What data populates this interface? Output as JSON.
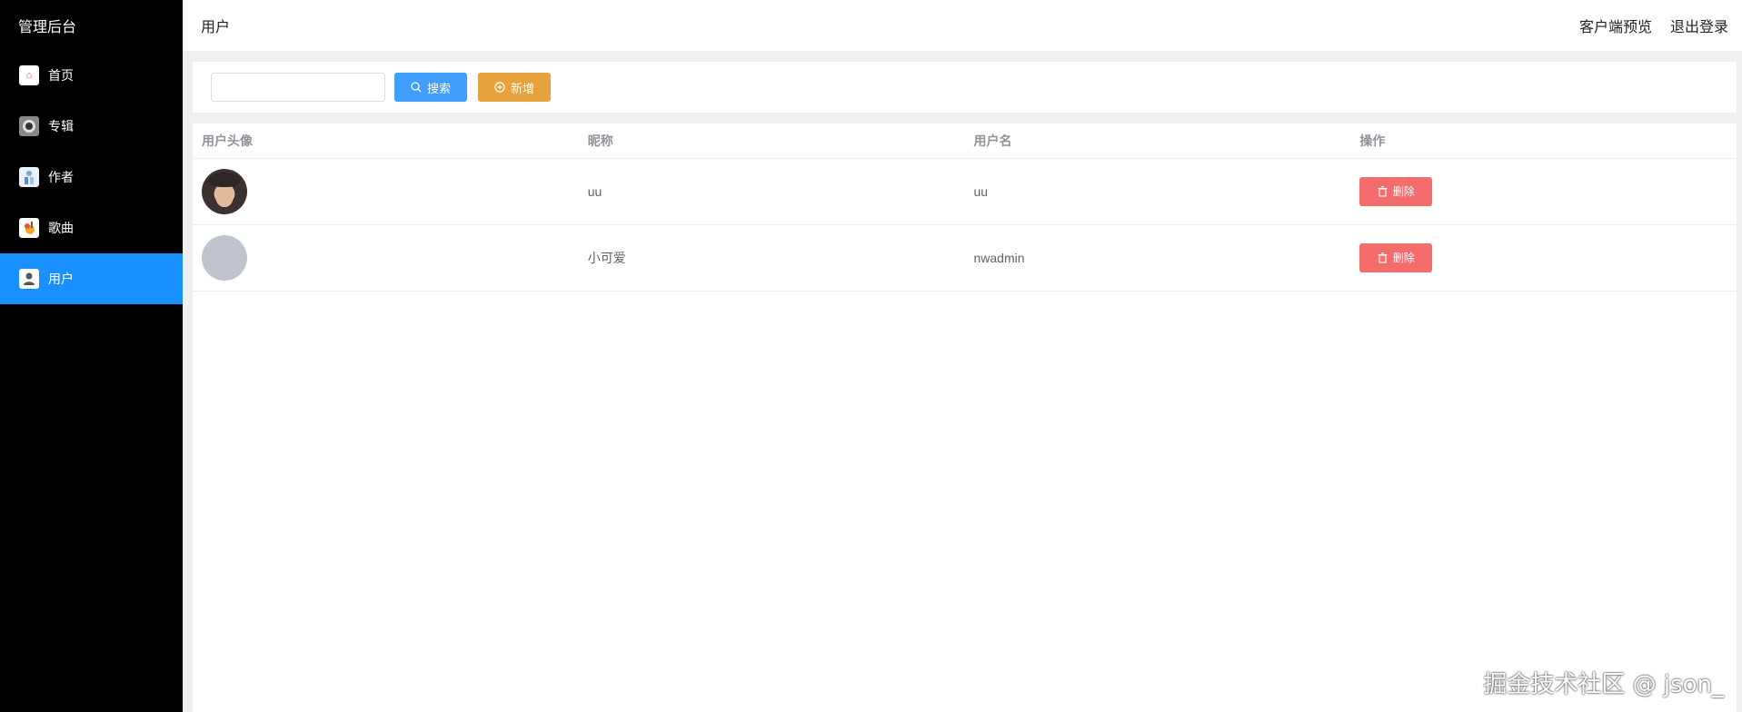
{
  "sidebar": {
    "title": "管理后台",
    "items": [
      {
        "label": "首页",
        "icon": "home-icon",
        "active": false
      },
      {
        "label": "专辑",
        "icon": "disc-icon",
        "active": false
      },
      {
        "label": "作者",
        "icon": "author-icon",
        "active": false
      },
      {
        "label": "歌曲",
        "icon": "song-icon",
        "active": false
      },
      {
        "label": "用户",
        "icon": "user-icon",
        "active": true
      }
    ]
  },
  "header": {
    "title": "用户",
    "client_preview": "客户端预览",
    "logout": "退出登录"
  },
  "toolbar": {
    "search_value": "",
    "search_placeholder": "",
    "search_label": "搜索",
    "add_label": "新增"
  },
  "table": {
    "columns": [
      "用户头像",
      "昵称",
      "用户名",
      "操作"
    ],
    "rows": [
      {
        "avatar": "photo",
        "nickname": "uu",
        "username": "uu",
        "action": "删除"
      },
      {
        "avatar": "empty",
        "nickname": "小可爱",
        "username": "nwadmin",
        "action": "删除"
      }
    ]
  },
  "watermark": "掘金技术社区 @ json_",
  "colors": {
    "sidebar_bg": "#000000",
    "active": "#1890ff",
    "primary": "#409eff",
    "warning": "#e6a23c",
    "danger": "#f56c6c"
  }
}
